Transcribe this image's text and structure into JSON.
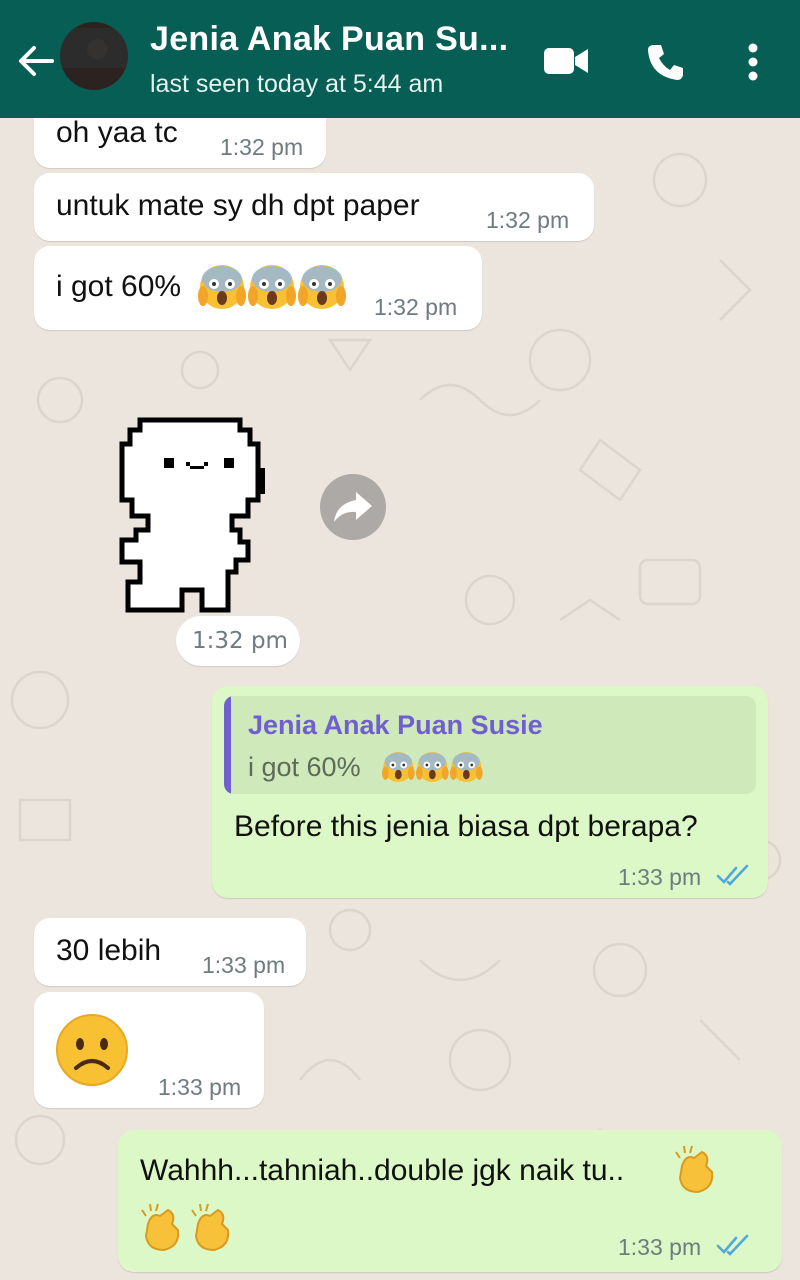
{
  "header": {
    "contact_name": "Jenia Anak Puan Su...",
    "status": "last seen today at 5:44 am",
    "accent": "#075e54"
  },
  "icons": [
    "back-arrow-icon",
    "avatar",
    "video-call-icon",
    "voice-call-icon",
    "more-options-icon",
    "forward-icon"
  ],
  "messages": [
    {
      "direction": "in",
      "text": "oh yaa tc",
      "time": "1:32 pm"
    },
    {
      "direction": "in",
      "text": "untuk mate sy dh dpt paper",
      "time": "1:32 pm"
    },
    {
      "direction": "in",
      "text": "i got 60%",
      "emoji": "face-screaming-in-fear x3",
      "time": "1:32 pm"
    },
    {
      "direction": "in",
      "type": "sticker",
      "time": "1:32 pm"
    },
    {
      "direction": "out",
      "reply_to": {
        "name": "Jenia Anak Puan Susie",
        "text": "i got 60%"
      },
      "text": "Before this jenia biasa dpt berapa?",
      "time": "1:33 pm",
      "status": "read"
    },
    {
      "direction": "in",
      "text": "30 lebih",
      "time": "1:33 pm"
    },
    {
      "direction": "in",
      "emoji": "frowning-face",
      "time": "1:33 pm"
    },
    {
      "direction": "out",
      "text": "Wahhh...tahniah..double jgk naik tu..",
      "emoji": "clapping-hands x3",
      "time": "1:33 pm",
      "status": "read"
    }
  ],
  "colors": {
    "incoming": "#ffffff",
    "outgoing": "#dcf8c6",
    "read_ticks": "#4fa8e0",
    "quote_name": "#6f5fcf"
  }
}
